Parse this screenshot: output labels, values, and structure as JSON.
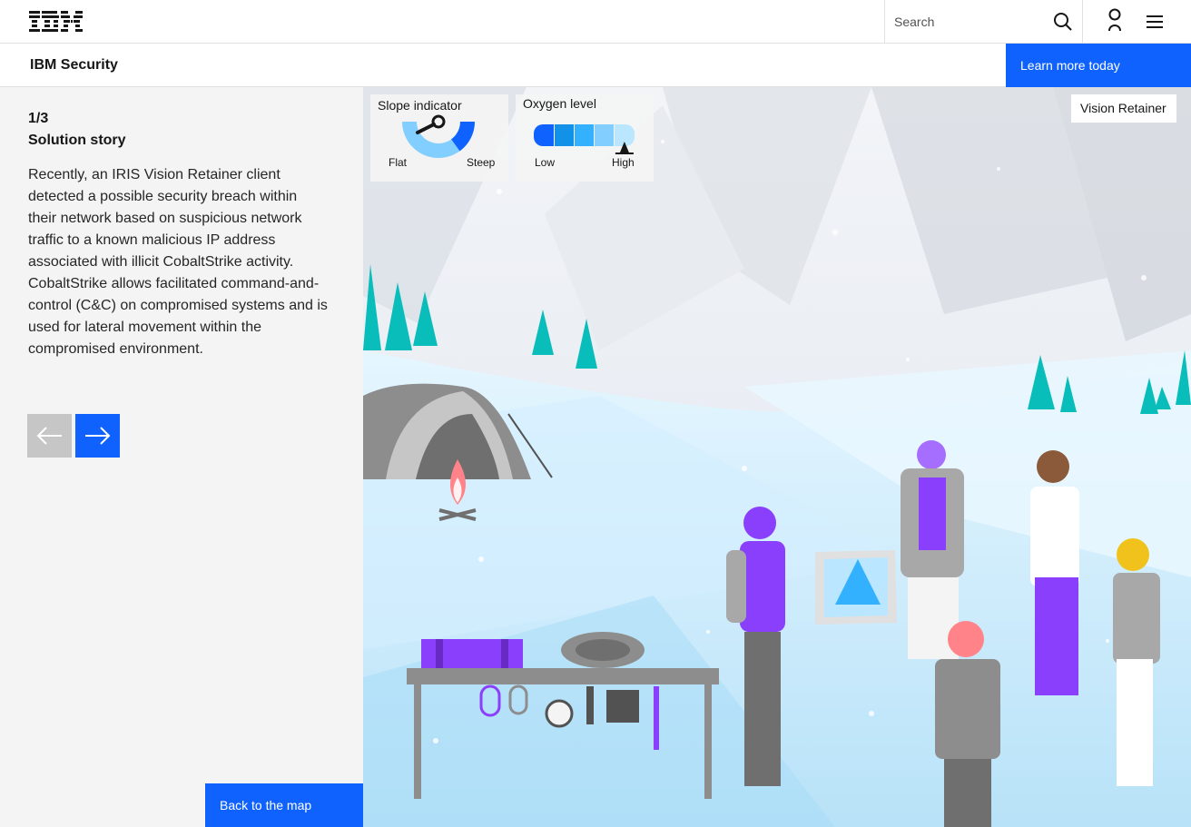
{
  "masthead": {
    "logo_text": "IBM",
    "search_placeholder": "Search",
    "icons": [
      "search-icon",
      "user-icon",
      "menu-icon"
    ]
  },
  "subheader": {
    "title": "IBM Security",
    "cta_label": "Learn more today"
  },
  "story": {
    "counter": "1/3",
    "title": "Solution story",
    "body": "Recently, an IRIS Vision Retainer client detected a possible security breach within their network based on suspicious network traffic to a known malicious IP address associated with illicit CobaltStrike activity. CobaltStrike allows facilitated command-and-control (C&C) on compromised systems and is used for lateral movement within the compromised environment.",
    "prev_icon": "arrow-left-icon",
    "next_icon": "arrow-right-icon",
    "back_label": "Back to the map"
  },
  "indicators": {
    "slope": {
      "title": "Slope indicator",
      "low_label": "Flat",
      "high_label": "Steep",
      "level": 0.7
    },
    "oxygen": {
      "title": "Oxygen level",
      "low_label": "Low",
      "high_label": "High",
      "level": 0.9
    }
  },
  "scene": {
    "tag_label": "Vision Retainer"
  },
  "colors": {
    "primary": "#0f62fe",
    "left_panel_bg": "#f4f4f4",
    "accent_purple": "#8a3ffc",
    "tree_teal": "#08bdba",
    "ice_blue": "#bae6ff"
  }
}
